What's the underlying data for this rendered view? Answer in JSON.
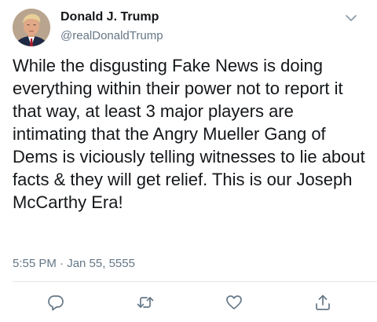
{
  "tweet": {
    "author": {
      "display_name": "Donald J. Trump",
      "handle": "@realDonaldTrump",
      "avatar_icon": "profile-photo"
    },
    "text": "While the disgusting Fake News is doing everything within their power not to report it that way, at least 3 major players are intimating that the Angry Mueller Gang of Dems is viciously telling witnesses to lie about facts & they will get relief. This is our Joseph McCarthy Era!",
    "timestamp": "5:55 PM · Jan 55, 5555"
  },
  "actions": [
    {
      "name": "reply",
      "icon": "reply-icon"
    },
    {
      "name": "retweet",
      "icon": "retweet-icon"
    },
    {
      "name": "like",
      "icon": "heart-icon"
    },
    {
      "name": "share",
      "icon": "share-icon"
    }
  ],
  "colors": {
    "text": "#14171a",
    "secondary": "#657786",
    "divider": "#e1e8ed"
  }
}
